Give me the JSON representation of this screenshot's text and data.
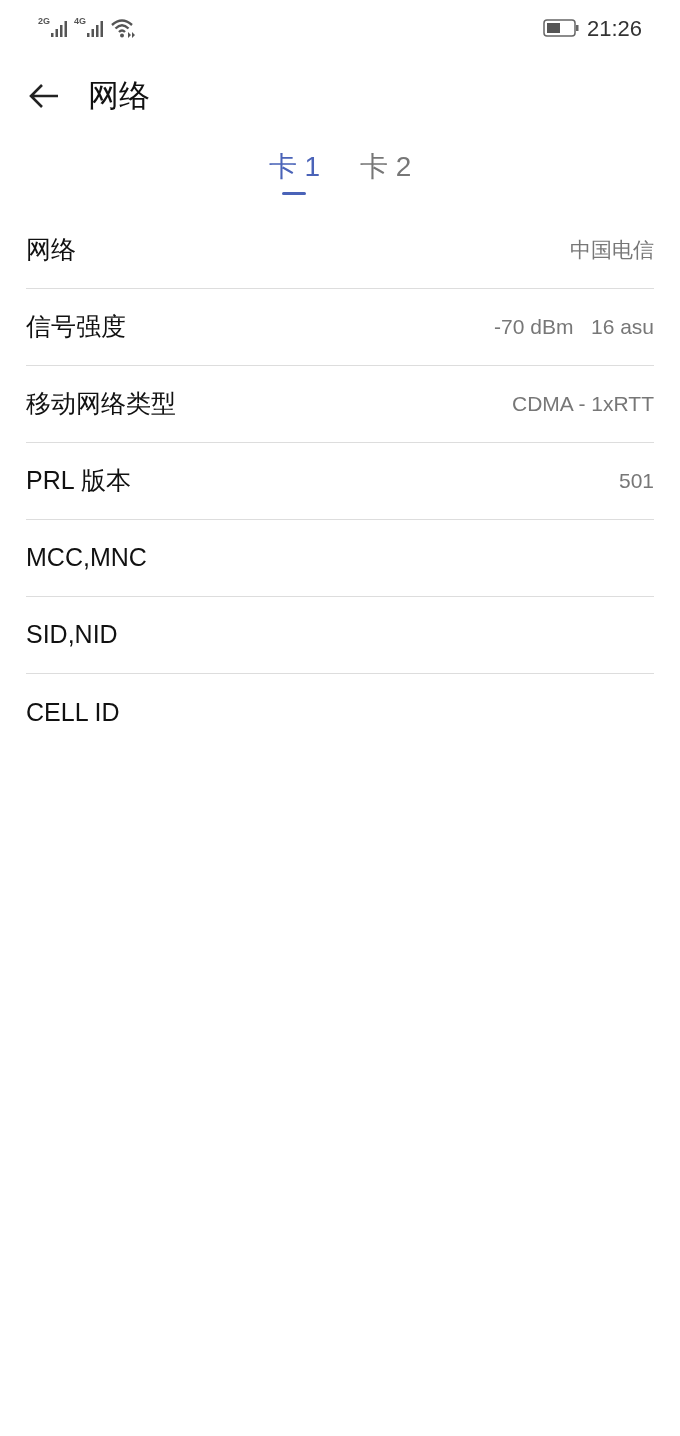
{
  "status_bar": {
    "sim_1_network": "2G",
    "sim_2_network": "4G",
    "time": "21:26"
  },
  "header": {
    "title": "网络"
  },
  "tabs": [
    {
      "label": "卡 1",
      "selected": true
    },
    {
      "label": "卡 2",
      "selected": false
    }
  ],
  "rows": [
    {
      "label": "网络",
      "value": "中国电信"
    },
    {
      "label": "信号强度",
      "value": "-70 dBm   16 asu"
    },
    {
      "label": "移动网络类型",
      "value": "CDMA - 1xRTT"
    },
    {
      "label": "PRL 版本",
      "value": "501"
    },
    {
      "label": "MCC,MNC"
    },
    {
      "label": "SID,NID"
    },
    {
      "label": "CELL ID"
    }
  ]
}
